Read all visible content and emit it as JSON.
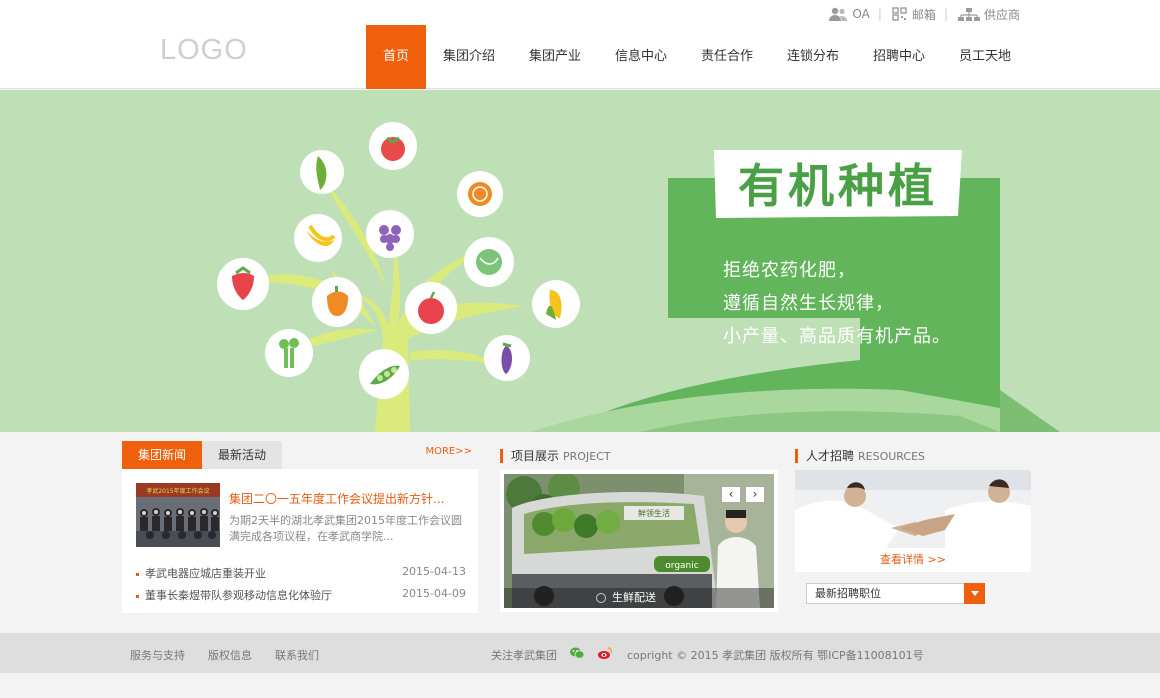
{
  "header": {
    "logo": "LOGO",
    "toplinks": {
      "oa": "OA",
      "mail": "邮箱",
      "supplier": "供应商"
    },
    "nav": [
      "首页",
      "集团介绍",
      "集团产业",
      "信息中心",
      "责任合作",
      "连锁分布",
      "招聘中心",
      "员工天地"
    ]
  },
  "banner": {
    "headline": "有机种植",
    "lines": [
      "拒绝农药化肥，",
      "遵循自然生长规律，",
      "小产量、高品质有机产品。"
    ],
    "van_text": "鲜领生活"
  },
  "news": {
    "tabs": [
      "集团新闻",
      "最新活动"
    ],
    "more": "MORE>>",
    "featured_title": "集团二〇一五年度工作会议提出新方针...",
    "featured_summary": "为期2天半的湖北孝武集团2015年度工作会议圆满完成各项议程，在孝武商学院...",
    "thumb_banner": "孝武2015年度工作会议",
    "items": [
      {
        "title": "孝武电器应城店重装开业",
        "date": "2015-04-13"
      },
      {
        "title": "董事长秦煜带队参观移动信息化体验厅",
        "date": "2015-04-09"
      }
    ]
  },
  "project": {
    "title": "项目展示",
    "title_en": "PROJECT",
    "prev": "‹",
    "next": "›",
    "caption": "生鲜配送",
    "van_label": "organic"
  },
  "hr": {
    "title": "人才招聘",
    "title_en": "RESOURCES",
    "link": "查看详情 >>",
    "select_value": "最新招聘职位"
  },
  "footer": {
    "links": [
      "服务与支持",
      "版权信息",
      "联系我们"
    ],
    "follow": "关注孝武集团",
    "copyright": "copright © 2015 孝武集团 版权所有 鄂ICP备11008101号"
  },
  "colors": {
    "accent": "#f0600c",
    "banner_bg": "#bfe0b7",
    "banner_green": "#62b55b"
  }
}
